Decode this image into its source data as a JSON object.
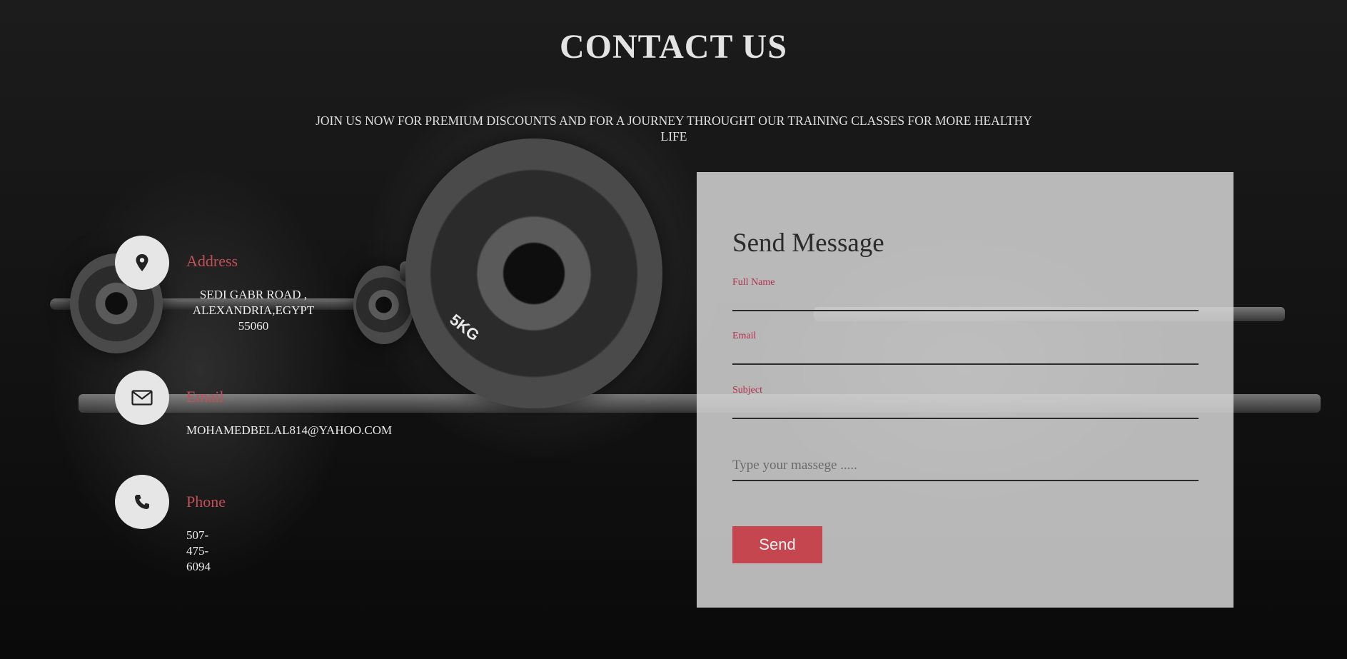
{
  "header": {
    "title": "CONTACT US",
    "subtitle": "JOIN US NOW FOR PREMIUM DISCOUNTS AND FOR A JOURNEY THROUGHT OUR TRAINING CLASSES FOR MORE HEALTHY LIFE"
  },
  "background": {
    "plate_label": "5KG"
  },
  "contact_info": {
    "address": {
      "icon": "map-pin-icon",
      "label": "Address",
      "value": "SEDI GABR ROAD , ALEXANDRIA,EGYPT 55060"
    },
    "email": {
      "icon": "envelope-icon",
      "label": "Email",
      "value": "MOHAMEDBELAL814@YAHOO.COM"
    },
    "phone": {
      "icon": "phone-icon",
      "label": "Phone",
      "value": "507-475-6094"
    }
  },
  "form": {
    "title": "Send Message",
    "fields": {
      "full_name": {
        "label": "Full Name",
        "value": ""
      },
      "email": {
        "label": "Email",
        "value": ""
      },
      "subject": {
        "label": "Subject",
        "value": ""
      }
    },
    "message_placeholder": "Type your massege .....",
    "send_label": "Send"
  },
  "colors": {
    "accent": "#c6464f",
    "label_red": "#c24f57",
    "field_label": "#b0304a",
    "panel_bg": "#d6d6d6"
  }
}
